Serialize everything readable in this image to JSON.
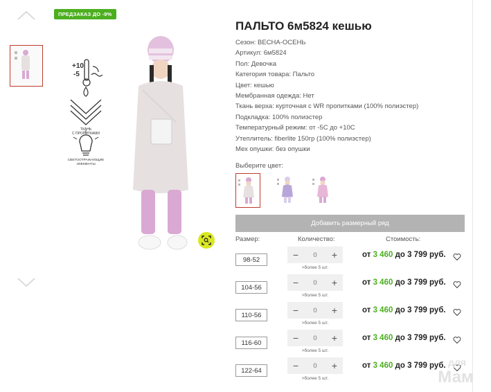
{
  "badge": {
    "promo": "ПРЕДЗАКАЗ ДО -9%"
  },
  "product": {
    "title": "ПАЛЬТО 6м5824 кешью",
    "attributes": [
      "Сезон: ВЕСНА-ОСЕНЬ",
      "Артикул: 6м5824",
      "Пол: Девочка",
      "Категория товара: Пальто",
      "Цвет: кешью",
      "Мембранная одежда: Нет",
      "Ткань верха: курточная с WR пропитками (100% полиэстер)",
      "Подкладка: 100% полиэстер",
      "Температурный режим: от -5С до +10С",
      "Утеплитель: fiberlite 150гр (100% полиэстер)",
      "Мех опушки: без опушки"
    ]
  },
  "feature_icons": {
    "temp_plus": "+10",
    "temp_minus": "-5",
    "fabric_line1": "ТКАНЬ",
    "fabric_line2": "С ПРОПИТКАМИ",
    "reflective_line1": "СВЕТООТРАЖАЮЩИЕ",
    "reflective_line2": "ЭЛЕМЕНТЫ"
  },
  "colors": {
    "label": "Выберите цвет:",
    "swatches": [
      {
        "name": "кешью",
        "coat": "#e6e1e0",
        "pants": "#d9a9d3",
        "active": true
      },
      {
        "name": "lavender",
        "coat": "#b7a6d9",
        "pants": "#d9cfea",
        "active": false
      },
      {
        "name": "pink",
        "coat": "#e8b7d8",
        "pants": "#d9a9d3",
        "active": false
      }
    ]
  },
  "add_size_row_label": "Добавить размерный ряд",
  "table": {
    "headers": {
      "size": "Размер:",
      "qty": "Количество:",
      "price": "Стоимость:"
    },
    "rows": [
      {
        "size": "98-52",
        "qty": "0",
        "avail": ">более 5 шт.",
        "price_from": "от",
        "price_low": "3 460",
        "price_to": "до 3 799 руб."
      },
      {
        "size": "104-56",
        "qty": "0",
        "avail": ">более 5 шт.",
        "price_from": "от",
        "price_low": "3 460",
        "price_to": "до 3 799 руб."
      },
      {
        "size": "110-56",
        "qty": "0",
        "avail": ">более 5 шт.",
        "price_from": "от",
        "price_low": "3 460",
        "price_to": "до 3 799 руб."
      },
      {
        "size": "116-60",
        "qty": "0",
        "avail": ">более 5 шт.",
        "price_from": "от",
        "price_low": "3 460",
        "price_to": "до 3 799 руб."
      },
      {
        "size": "122-64",
        "qty": "0",
        "avail": ">более 5 шт.",
        "price_from": "от",
        "price_low": "3 460",
        "price_to": "до 3 799 руб."
      }
    ]
  },
  "controls": {
    "minus": "−",
    "plus": "+"
  },
  "watermark": {
    "line1": "для",
    "line2": "Мам"
  },
  "theme": {
    "accent_green": "#4caf1f",
    "active_border": "#c0392b",
    "zoom_button": "#d8e821",
    "disabled_button": "#b3b3b3"
  }
}
